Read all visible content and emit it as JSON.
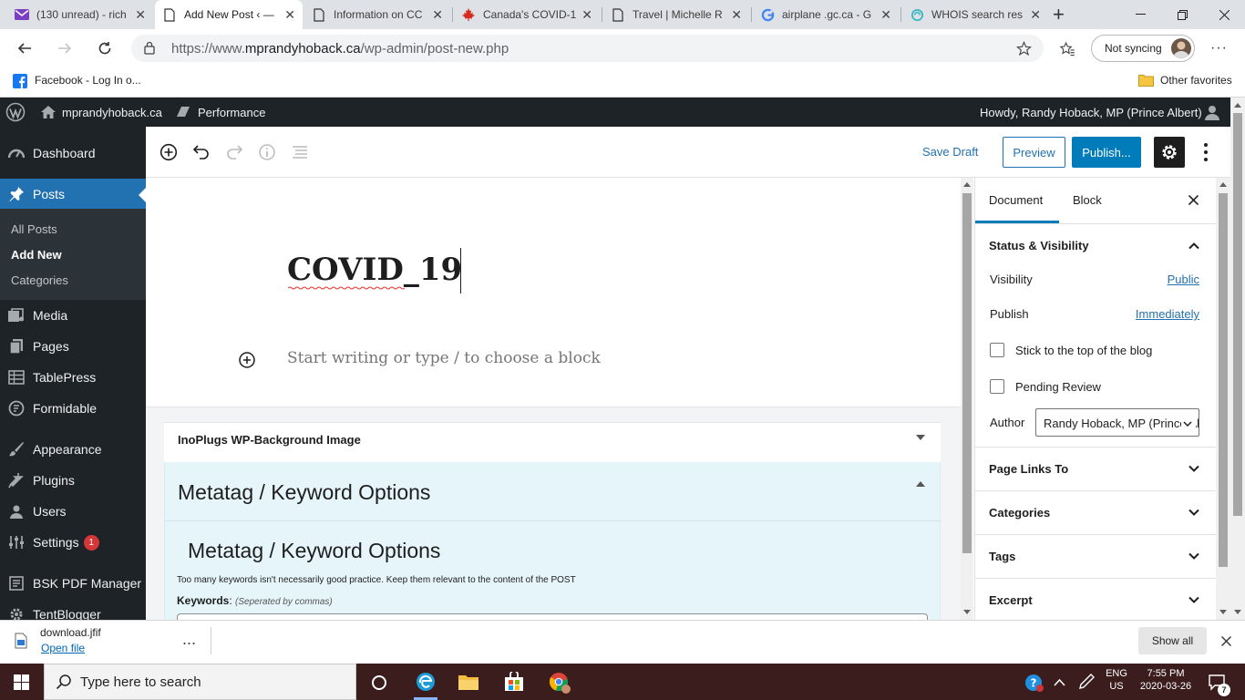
{
  "browser": {
    "tabs": [
      {
        "title": "(130 unread) - rich",
        "icon": "mail-icon",
        "active": false
      },
      {
        "title": "Add New Post ‹ — ",
        "icon": "page-icon",
        "active": true
      },
      {
        "title": "Information on CC",
        "icon": "page-icon",
        "active": false
      },
      {
        "title": "Canada's COVID-1",
        "icon": "maple-leaf-icon",
        "active": false
      },
      {
        "title": "Travel | Michelle R",
        "icon": "page-icon",
        "active": false
      },
      {
        "title": "airplane .gc.ca - G",
        "icon": "google-icon",
        "active": false
      },
      {
        "title": "WHOIS search res",
        "icon": "whois-icon",
        "active": false
      }
    ],
    "new_tab_label": "+",
    "url_prefix": "https://www.",
    "url_domain": "mprandyhoback.ca",
    "url_path": "/wp-admin/post-new.php",
    "sync_label": "Not syncing",
    "favorites": {
      "item": "Facebook - Log In o...",
      "other": "Other favorites"
    }
  },
  "wp_admin_bar": {
    "site_name": "mprandyhoback.ca",
    "performance": "Performance",
    "howdy": "Howdy, Randy Hoback, MP (Prince Albert)"
  },
  "sidebar": {
    "dashboard": "Dashboard",
    "posts": "Posts",
    "all_posts": "All Posts",
    "add_new": "Add New",
    "categories": "Categories",
    "media": "Media",
    "pages": "Pages",
    "tablepress": "TablePress",
    "formidable": "Formidable",
    "appearance": "Appearance",
    "plugins": "Plugins",
    "users": "Users",
    "settings": "Settings",
    "settings_badge": "1",
    "bsk": "BSK PDF Manager",
    "tentblogger": "TentBlogger"
  },
  "editor": {
    "save_draft": "Save Draft",
    "preview": "Preview",
    "publish": "Publish...",
    "post_title": "COVID_19",
    "block_placeholder": "Start writing or type / to choose a block"
  },
  "metaboxes": {
    "inoplugs": "InoPlugs WP-Background Image",
    "metatag_title": "Metatag / Keyword Options",
    "metatag_heading": "Metatag / Keyword Options",
    "note": "Too many keywords isn't necessarily good practice. Keep them relevant to the content of the POST",
    "keywords_label": "Keywords",
    "keywords_hint": "(Seperated by commas)"
  },
  "settings_panel": {
    "tab_document": "Document",
    "tab_block": "Block",
    "status_visibility": "Status & Visibility",
    "visibility_label": "Visibility",
    "visibility_value": "Public",
    "publish_label": "Publish",
    "publish_value": "Immediately",
    "sticky_label": "Stick to the top of the blog",
    "pending_label": "Pending Review",
    "author_label": "Author",
    "author_value": "Randy Hoback, MP (Prince Albert)",
    "page_links_to": "Page Links To",
    "categories": "Categories",
    "tags": "Tags",
    "excerpt": "Excerpt"
  },
  "downloads": {
    "file_name": "download.jfif",
    "open_file": "Open file",
    "more": "...",
    "show_all": "Show all"
  },
  "taskbar": {
    "search_placeholder": "Type here to search",
    "lang_top": "ENG",
    "lang_bottom": "US",
    "time": "7:55 PM",
    "date": "2020-03-26",
    "notifications": "7"
  },
  "colors": {
    "wp_dark": "#1d2327",
    "wp_blue": "#2271b1",
    "publish_blue": "#007cba",
    "metabox_blue": "#e5f5fa",
    "taskbar": "#3b1d1e"
  }
}
